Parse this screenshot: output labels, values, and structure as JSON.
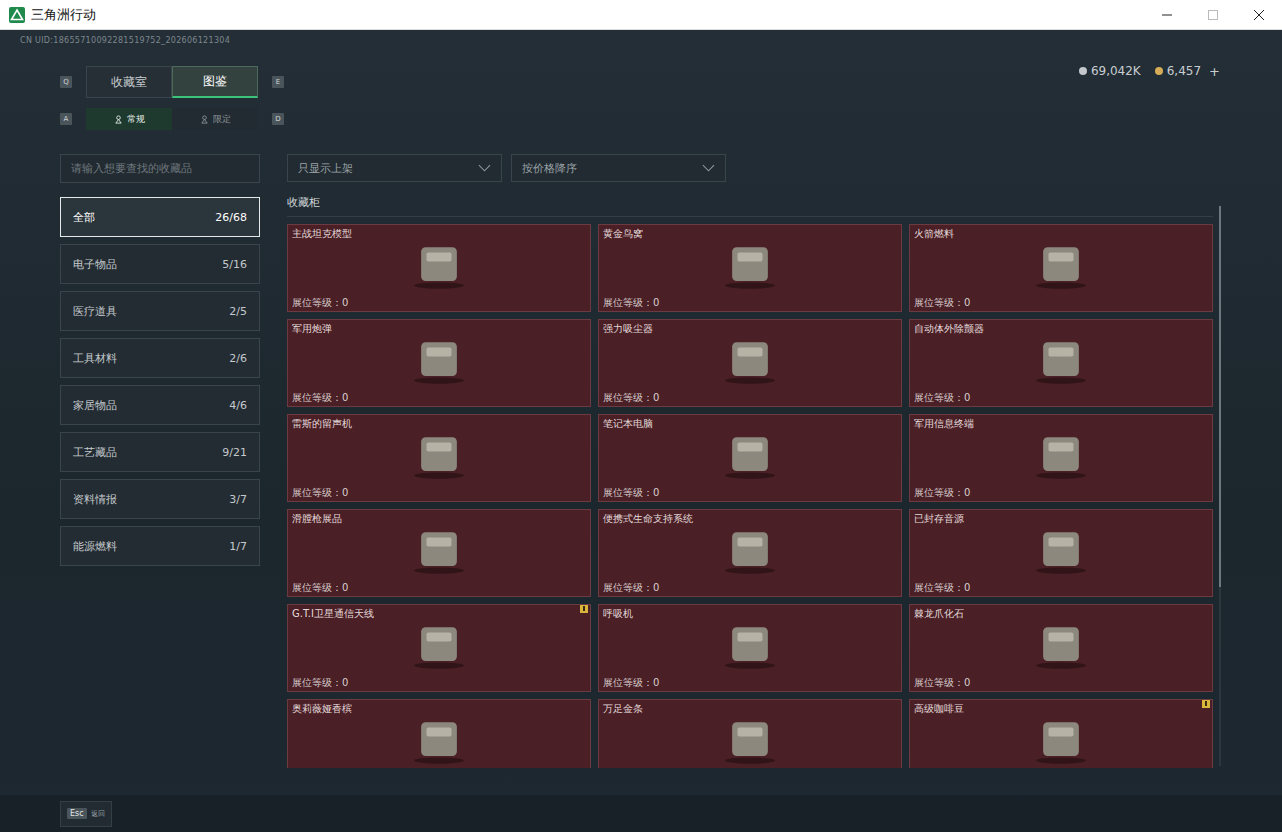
{
  "window": {
    "title": "三角洲行动"
  },
  "uid": "CN UID:18655710092281519752_202606121304",
  "currency": [
    {
      "kind": "silver",
      "amount": "69,042K"
    },
    {
      "kind": "gold",
      "amount": "6,457"
    }
  ],
  "add_button": "+",
  "main_tabs": {
    "prev_key": "Q",
    "next_key": "E",
    "items": [
      {
        "label": "收藏室",
        "selected": false
      },
      {
        "label": "图鉴",
        "selected": true
      }
    ]
  },
  "sub_tabs": {
    "prev_key": "A",
    "next_key": "D",
    "items": [
      {
        "label": "常规",
        "selected": true
      },
      {
        "label": "限定",
        "selected": false
      }
    ]
  },
  "search": {
    "placeholder": "请输入想要查找的收藏品"
  },
  "filters": [
    {
      "label": "只显示上架"
    },
    {
      "label": "按价格降序"
    }
  ],
  "categories": [
    {
      "label": "全部",
      "count": "26/68",
      "selected": true
    },
    {
      "label": "电子物品",
      "count": "5/16",
      "selected": false
    },
    {
      "label": "医疗道具",
      "count": "2/5",
      "selected": false
    },
    {
      "label": "工具材料",
      "count": "2/6",
      "selected": false
    },
    {
      "label": "家居物品",
      "count": "4/6",
      "selected": false
    },
    {
      "label": "工艺藏品",
      "count": "9/21",
      "selected": false
    },
    {
      "label": "资料情报",
      "count": "3/7",
      "selected": false
    },
    {
      "label": "能源燃料",
      "count": "1/7",
      "selected": false
    }
  ],
  "section_title": "收藏柜",
  "level_label": "展位等级：",
  "items": [
    {
      "name": "主战坦克模型",
      "level": "0",
      "alert": false
    },
    {
      "name": "黄金鸟窝",
      "level": "0",
      "alert": false
    },
    {
      "name": "火箭燃料",
      "level": "0",
      "alert": false
    },
    {
      "name": "军用炮弹",
      "level": "0",
      "alert": false
    },
    {
      "name": "强力吸尘器",
      "level": "0",
      "alert": false
    },
    {
      "name": "自动体外除颤器",
      "level": "0",
      "alert": false
    },
    {
      "name": "雷斯的留声机",
      "level": "0",
      "alert": false
    },
    {
      "name": "笔记本电脑",
      "level": "0",
      "alert": false
    },
    {
      "name": "军用信息终端",
      "level": "0",
      "alert": false
    },
    {
      "name": "滑膛枪展品",
      "level": "0",
      "alert": false
    },
    {
      "name": "便携式生命支持系统",
      "level": "0",
      "alert": false
    },
    {
      "name": "已封存音源",
      "level": "0",
      "alert": false
    },
    {
      "name": "G.T.I卫星通信天线",
      "level": "0",
      "alert": true
    },
    {
      "name": "呼吸机",
      "level": "0",
      "alert": false
    },
    {
      "name": "棘龙爪化石",
      "level": "0",
      "alert": false
    },
    {
      "name": "奥莉薇娅香槟",
      "alert": false
    },
    {
      "name": "万足金条",
      "alert": false
    },
    {
      "name": "高级咖啡豆",
      "alert": true
    }
  ],
  "scrollbar": {
    "level": 0.68
  },
  "footer": {
    "key": "Esc",
    "label": "返回"
  }
}
